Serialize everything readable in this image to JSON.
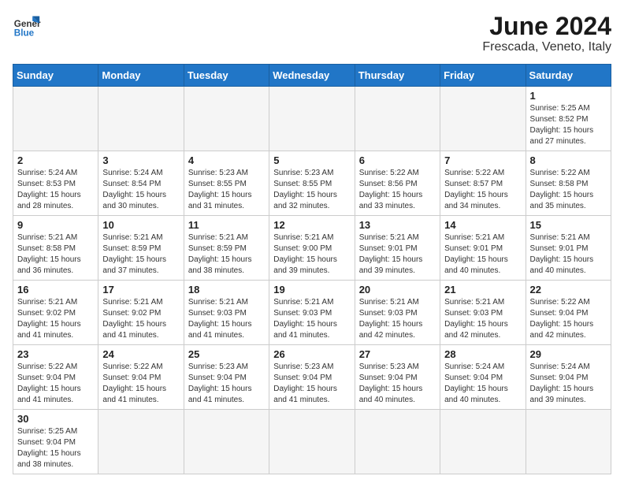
{
  "header": {
    "logo_general": "General",
    "logo_blue": "Blue",
    "title": "June 2024",
    "subtitle": "Frescada, Veneto, Italy"
  },
  "weekdays": [
    "Sunday",
    "Monday",
    "Tuesday",
    "Wednesday",
    "Thursday",
    "Friday",
    "Saturday"
  ],
  "weeks": [
    [
      {
        "day": "",
        "info": ""
      },
      {
        "day": "",
        "info": ""
      },
      {
        "day": "",
        "info": ""
      },
      {
        "day": "",
        "info": ""
      },
      {
        "day": "",
        "info": ""
      },
      {
        "day": "",
        "info": ""
      },
      {
        "day": "1",
        "info": "Sunrise: 5:25 AM\nSunset: 8:52 PM\nDaylight: 15 hours and 27 minutes."
      }
    ],
    [
      {
        "day": "2",
        "info": "Sunrise: 5:24 AM\nSunset: 8:53 PM\nDaylight: 15 hours and 28 minutes."
      },
      {
        "day": "3",
        "info": "Sunrise: 5:24 AM\nSunset: 8:54 PM\nDaylight: 15 hours and 30 minutes."
      },
      {
        "day": "4",
        "info": "Sunrise: 5:23 AM\nSunset: 8:55 PM\nDaylight: 15 hours and 31 minutes."
      },
      {
        "day": "5",
        "info": "Sunrise: 5:23 AM\nSunset: 8:55 PM\nDaylight: 15 hours and 32 minutes."
      },
      {
        "day": "6",
        "info": "Sunrise: 5:22 AM\nSunset: 8:56 PM\nDaylight: 15 hours and 33 minutes."
      },
      {
        "day": "7",
        "info": "Sunrise: 5:22 AM\nSunset: 8:57 PM\nDaylight: 15 hours and 34 minutes."
      },
      {
        "day": "8",
        "info": "Sunrise: 5:22 AM\nSunset: 8:58 PM\nDaylight: 15 hours and 35 minutes."
      }
    ],
    [
      {
        "day": "9",
        "info": "Sunrise: 5:21 AM\nSunset: 8:58 PM\nDaylight: 15 hours and 36 minutes."
      },
      {
        "day": "10",
        "info": "Sunrise: 5:21 AM\nSunset: 8:59 PM\nDaylight: 15 hours and 37 minutes."
      },
      {
        "day": "11",
        "info": "Sunrise: 5:21 AM\nSunset: 8:59 PM\nDaylight: 15 hours and 38 minutes."
      },
      {
        "day": "12",
        "info": "Sunrise: 5:21 AM\nSunset: 9:00 PM\nDaylight: 15 hours and 39 minutes."
      },
      {
        "day": "13",
        "info": "Sunrise: 5:21 AM\nSunset: 9:01 PM\nDaylight: 15 hours and 39 minutes."
      },
      {
        "day": "14",
        "info": "Sunrise: 5:21 AM\nSunset: 9:01 PM\nDaylight: 15 hours and 40 minutes."
      },
      {
        "day": "15",
        "info": "Sunrise: 5:21 AM\nSunset: 9:01 PM\nDaylight: 15 hours and 40 minutes."
      }
    ],
    [
      {
        "day": "16",
        "info": "Sunrise: 5:21 AM\nSunset: 9:02 PM\nDaylight: 15 hours and 41 minutes."
      },
      {
        "day": "17",
        "info": "Sunrise: 5:21 AM\nSunset: 9:02 PM\nDaylight: 15 hours and 41 minutes."
      },
      {
        "day": "18",
        "info": "Sunrise: 5:21 AM\nSunset: 9:03 PM\nDaylight: 15 hours and 41 minutes."
      },
      {
        "day": "19",
        "info": "Sunrise: 5:21 AM\nSunset: 9:03 PM\nDaylight: 15 hours and 41 minutes."
      },
      {
        "day": "20",
        "info": "Sunrise: 5:21 AM\nSunset: 9:03 PM\nDaylight: 15 hours and 42 minutes."
      },
      {
        "day": "21",
        "info": "Sunrise: 5:21 AM\nSunset: 9:03 PM\nDaylight: 15 hours and 42 minutes."
      },
      {
        "day": "22",
        "info": "Sunrise: 5:22 AM\nSunset: 9:04 PM\nDaylight: 15 hours and 42 minutes."
      }
    ],
    [
      {
        "day": "23",
        "info": "Sunrise: 5:22 AM\nSunset: 9:04 PM\nDaylight: 15 hours and 41 minutes."
      },
      {
        "day": "24",
        "info": "Sunrise: 5:22 AM\nSunset: 9:04 PM\nDaylight: 15 hours and 41 minutes."
      },
      {
        "day": "25",
        "info": "Sunrise: 5:23 AM\nSunset: 9:04 PM\nDaylight: 15 hours and 41 minutes."
      },
      {
        "day": "26",
        "info": "Sunrise: 5:23 AM\nSunset: 9:04 PM\nDaylight: 15 hours and 41 minutes."
      },
      {
        "day": "27",
        "info": "Sunrise: 5:23 AM\nSunset: 9:04 PM\nDaylight: 15 hours and 40 minutes."
      },
      {
        "day": "28",
        "info": "Sunrise: 5:24 AM\nSunset: 9:04 PM\nDaylight: 15 hours and 40 minutes."
      },
      {
        "day": "29",
        "info": "Sunrise: 5:24 AM\nSunset: 9:04 PM\nDaylight: 15 hours and 39 minutes."
      }
    ],
    [
      {
        "day": "30",
        "info": "Sunrise: 5:25 AM\nSunset: 9:04 PM\nDaylight: 15 hours and 38 minutes."
      },
      {
        "day": "",
        "info": ""
      },
      {
        "day": "",
        "info": ""
      },
      {
        "day": "",
        "info": ""
      },
      {
        "day": "",
        "info": ""
      },
      {
        "day": "",
        "info": ""
      },
      {
        "day": "",
        "info": ""
      }
    ]
  ]
}
